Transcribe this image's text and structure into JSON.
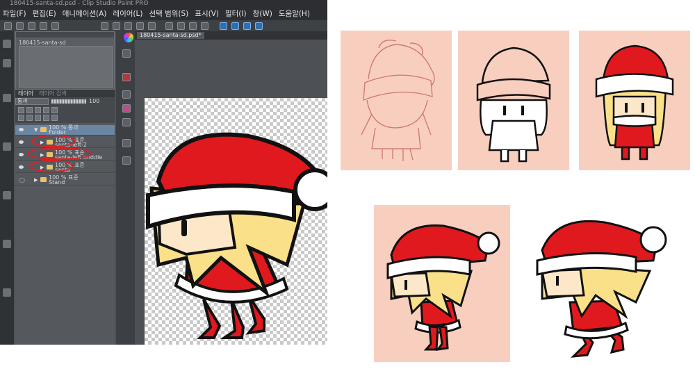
{
  "window": {
    "title": "180415-santa-sd.psd - Clip Studio Paint PRO"
  },
  "menu": [
    {
      "label": "파일(F)",
      "name": "menu-file"
    },
    {
      "label": "편집(E)",
      "name": "menu-edit"
    },
    {
      "label": "애니메이션(A)",
      "name": "menu-animation"
    },
    {
      "label": "레이어(L)",
      "name": "menu-layer"
    },
    {
      "label": "선택 범위(S)",
      "name": "menu-selection"
    },
    {
      "label": "표시(V)",
      "name": "menu-view"
    },
    {
      "label": "필터(I)",
      "name": "menu-filter"
    },
    {
      "label": "창(W)",
      "name": "menu-window"
    },
    {
      "label": "도움말(H)",
      "name": "menu-help"
    }
  ],
  "navigator": {
    "file_label": "180415-santa-sd"
  },
  "layer_panel": {
    "tabs": [
      {
        "label": "레이어",
        "name": "tab-layer"
      },
      {
        "label": "레이어 검색",
        "name": "tab-layer-search"
      }
    ],
    "blend_mode": "통과",
    "opacity": "100",
    "layers": [
      {
        "name": "layer-row-folder-main",
        "line1": "100 % 통과",
        "line2": "Folder",
        "expanded": true,
        "selected": true
      },
      {
        "name": "layer-row-santa-left-2",
        "line1": "100 % 표준",
        "line2": "santa-left-2",
        "expanded": false,
        "selected": false
      },
      {
        "name": "layer-row-santa-left-middle",
        "line1": "100 % 표준",
        "line2": "santa-left-middle",
        "expanded": false,
        "selected": false
      },
      {
        "name": "layer-row-santa",
        "line1": "100 % 표준",
        "line2": "santa",
        "expanded": false,
        "selected": false
      },
      {
        "name": "layer-row-stand",
        "line1": "100 % 표준",
        "line2": "Stand",
        "expanded": false,
        "selected": false
      }
    ]
  },
  "canvas": {
    "tab_label": "180415-santa-sd.psd*"
  },
  "colors": {
    "hat_red": "#e0191e",
    "fur_white": "#ffffff",
    "hair_blonde": "#fbe08a",
    "skin": "#fce8c8",
    "panel_bg": "#f8cfbe",
    "sketch_red": "#cf7b78",
    "annotation_red": "#e01f26"
  },
  "icons": [
    "color-wheel-icon",
    "eye-icon",
    "folder-icon",
    "expand-arrow-icon"
  ]
}
